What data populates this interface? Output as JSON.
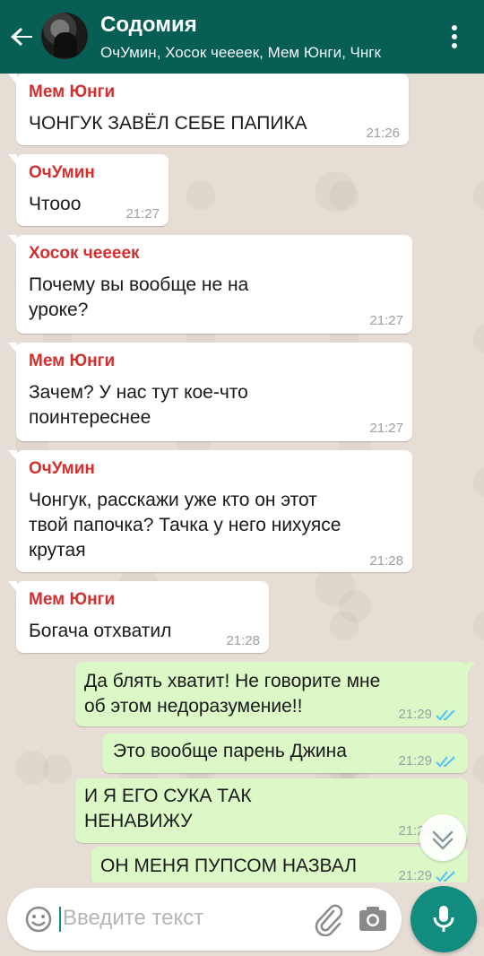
{
  "header": {
    "title": "Содомия",
    "subtitle": "ОчУмин, Хосок чееeек, Мем Юнги, Чнгк"
  },
  "messages": [
    {
      "direction": "incoming",
      "sender": "Мем Юнги",
      "lines": [
        "ЧОНГУК ЗАВЁЛ СЕБЕ ПАПИКА"
      ],
      "time": "21:26"
    },
    {
      "direction": "incoming",
      "sender": "ОчУмин",
      "lines": [
        "Чтооо"
      ],
      "time": "21:27"
    },
    {
      "direction": "incoming",
      "sender": "Хосок чееeек",
      "lines": [
        "Почему вы вообще не на",
        "уроке?"
      ],
      "time": "21:27"
    },
    {
      "direction": "incoming",
      "sender": "Мем Юнги",
      "lines": [
        "Зачем? У нас тут кое-что",
        "поинтереснее"
      ],
      "time": "21:27"
    },
    {
      "direction": "incoming",
      "sender": "ОчУмин",
      "lines": [
        "Чонгук, расскажи уже кто он этот",
        "твой папочка? Тачка у него нихуясе",
        "крутая"
      ],
      "time": "21:28"
    },
    {
      "direction": "incoming",
      "sender": "Мем Юнги",
      "lines": [
        "Богача отхватил"
      ],
      "time": "21:28"
    },
    {
      "direction": "outgoing",
      "lines": [
        "Да блять хватит! Не говорите мне",
        "об этом недоразумение!!"
      ],
      "time": "21:29",
      "status": "read"
    },
    {
      "direction": "outgoing",
      "lines": [
        "Это вообще парень Джина"
      ],
      "time": "21:29",
      "status": "read"
    },
    {
      "direction": "outgoing",
      "lines": [
        "И Я ЕГО СУКА ТАК",
        "НЕНАВИЖУ"
      ],
      "time": "21:29",
      "status": "read"
    },
    {
      "direction": "outgoing",
      "lines": [
        "ОН МЕНЯ ПУПСОМ НАЗВАЛ"
      ],
      "time": "21:29",
      "status": "read"
    }
  ],
  "composer": {
    "placeholder": "Введите текст"
  },
  "colors": {
    "header": "#075e54",
    "accent": "#128c7e",
    "sender_name": "#d32f2f",
    "outgoing_bubble": "#dcf8c6",
    "read_ticks": "#4fc3f7"
  },
  "icons": [
    "back-arrow-icon",
    "more-vert-icon",
    "double-check-icon",
    "chevron-down-icon",
    "emoji-icon",
    "paperclip-icon",
    "camera-icon",
    "mic-icon"
  ]
}
